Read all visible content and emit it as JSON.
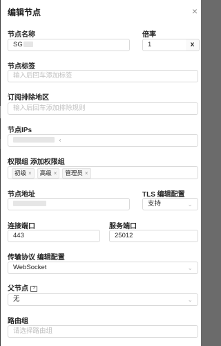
{
  "modal": {
    "title": "编辑节点",
    "close_label": "×"
  },
  "fields": {
    "node_name": {
      "label": "节点名称",
      "value": "SG"
    },
    "rate": {
      "label": "倍率",
      "value": "1",
      "clear_label": "x"
    },
    "node_tags": {
      "label": "节点标签",
      "placeholder": "输入后回车添加标签"
    },
    "subscribe_exclude": {
      "label": "订阅排除地区",
      "placeholder": "输入后回车添加排除规则"
    },
    "node_ips": {
      "label": "节点IPs",
      "suffix": "‹"
    },
    "permission_group": {
      "label": "权限组",
      "add_link": "添加权限组",
      "tags": [
        "初级",
        "高级",
        "管理员"
      ],
      "tag_remove": "×"
    },
    "node_address": {
      "label": "节点地址"
    },
    "tls": {
      "label": "TLS",
      "edit_link": "编辑配置",
      "value": "支持",
      "arrow": "⌄"
    },
    "connect_port": {
      "label": "连接端口",
      "value": "443"
    },
    "service_port": {
      "label": "服务端口",
      "value": "25012"
    },
    "transport": {
      "label": "传输协议",
      "edit_link": "编辑配置",
      "value": "WebSocket",
      "arrow": "⌄"
    },
    "parent_node": {
      "label": "父节点",
      "help_icon": "?",
      "value": "无",
      "arrow": "⌄"
    },
    "route_group": {
      "label": "路由组",
      "placeholder": "请选择路由组"
    }
  }
}
